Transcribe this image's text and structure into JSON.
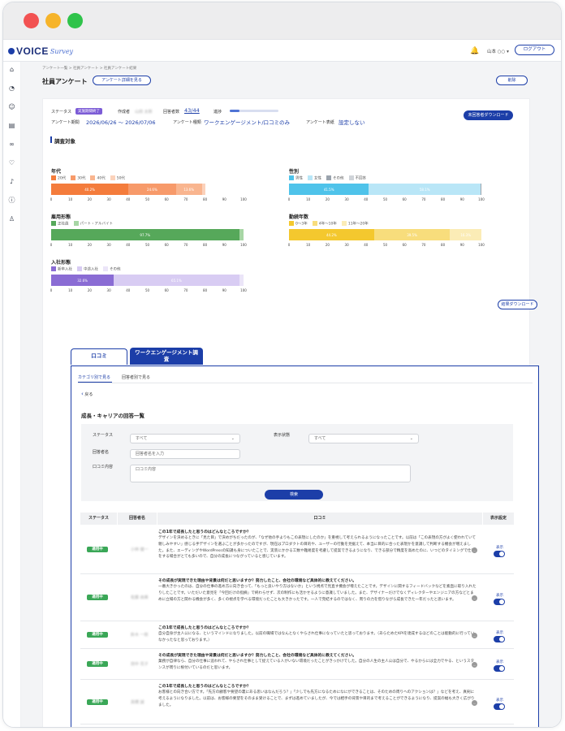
{
  "header": {
    "logo_text": "VOICE",
    "logo_script": "Survey",
    "user_label": "山本 ○○ ▾",
    "logout": "ログアウト"
  },
  "breadcrumb": "アンケート一覧  >  社員アンケート  >  社員アンケート結果",
  "page": {
    "title": "社員アンケート",
    "detail_button": "アンケート詳細を見る",
    "delete_button": "削除"
  },
  "summary": {
    "status_label": "ステータス",
    "status_value": "実施期間終了",
    "author_label": "作成者",
    "author_value": "山田 太郎",
    "respondents_label": "回答者数",
    "respondents_value": "43/44",
    "progress_label": "進捗",
    "progress_fraction": 0.2,
    "period_label": "アンケート期間",
    "period_value": "2026/06/26 〜 2026/07/06",
    "type_label": "アンケート種類",
    "type_value": "ワークエンゲージメント/口コミのみ",
    "display_label": "アンケート表紙",
    "display_value": "設定しない",
    "download_button": "未回答者ダウンロード"
  },
  "target": {
    "title": "調査対象",
    "ticks": [
      "0",
      "10",
      "20",
      "30",
      "40",
      "50",
      "60",
      "70",
      "80",
      "90",
      "100"
    ]
  },
  "chart_data": [
    {
      "type": "bar",
      "title": "年代",
      "categories": [
        "20代",
        "30代",
        "40代",
        "50代"
      ],
      "values": [
        40.2,
        24.6,
        13.6,
        1.6
      ],
      "labels": [
        "40.2%",
        "24.6%",
        "13.6%",
        ""
      ],
      "colors": [
        "#f47c3c",
        "#f79a6a",
        "#f9b58f",
        "#fbd2bb"
      ],
      "xlim": [
        0,
        100
      ]
    },
    {
      "type": "bar",
      "title": "性別",
      "categories": [
        "男性",
        "女性",
        "その他",
        "不回答"
      ],
      "values": [
        41.5,
        58.1,
        0.4,
        0
      ],
      "labels": [
        "41.5%",
        "58.1%",
        "",
        ""
      ],
      "colors": [
        "#4fc3ea",
        "#b9e6f7",
        "#9aa3ad",
        "#cfd3d8"
      ],
      "xlim": [
        0,
        100
      ]
    },
    {
      "type": "bar",
      "title": "雇用形態",
      "categories": [
        "正社員",
        "パート・アルバイト"
      ],
      "values": [
        97.7,
        2.3
      ],
      "labels": [
        "97.7%",
        ""
      ],
      "colors": [
        "#56a85a",
        "#a7d6a5"
      ],
      "xlim": [
        0,
        100
      ]
    },
    {
      "type": "bar",
      "title": "勤続年数",
      "categories": [
        "0〜3年",
        "4年〜10年",
        "11年〜20年"
      ],
      "values": [
        44.2,
        39.5,
        16.3
      ],
      "labels": [
        "44.2%",
        "39.5%",
        "16.3%"
      ],
      "colors": [
        "#f4c82e",
        "#f8dd7c",
        "#fbecb6"
      ],
      "xlim": [
        0,
        100
      ]
    },
    {
      "type": "bar",
      "title": "入社形態",
      "categories": [
        "新卒入社",
        "中途入社",
        "その他"
      ],
      "values": [
        32.6,
        65.1,
        2.3
      ],
      "labels": [
        "32.6%",
        "65.1%",
        ""
      ],
      "colors": [
        "#8a6cd4",
        "#d8ccf3",
        "#ebe5f8"
      ],
      "xlim": [
        0,
        100
      ]
    }
  ],
  "result_download": "結果ダウンロード",
  "tabs": [
    "口コミ",
    "ワークエンゲージメント調査"
  ],
  "subtabs": [
    "カテゴリ別で見る",
    "回答者別で見る"
  ],
  "back": "戻る",
  "list_title": "成長・キャリアの回答一覧",
  "filters": {
    "status_label": "ステータス",
    "status_value": "すべて",
    "display_label": "表示状態",
    "display_value": "すべて",
    "name_label": "回答者名",
    "name_placeholder": "回答者名を入力",
    "comment_label": "口コミ内容",
    "comment_placeholder": "口コミ内容",
    "search": "検索"
  },
  "table": {
    "headers": [
      "ステータス",
      "回答者名",
      "口コミ",
      "表示設定"
    ],
    "rows": [
      {
        "status": "適用中",
        "name": "小林 健一",
        "q": "この1年で成長したと思うのはどんなところですか？",
        "a": "デザインを決めるときに「見た目」で決めがちだったのが、「なぜ他の手よりもこの表現にしたのか」を重視して考えられるようになったことです。以前は「この表現の方がよく使われていて親しみやすい」感じる手デザインを選ぶことが多かったのですが、現在はプロダクトの目的や、ユーザーの行動を見据えて、本当に目的に合った表現かを意識して判断する機会が増えました。また、エーディングやWordPressの知識も身についたことで、実装にかかる工数や難易度を考慮して提案できるようになり、できる部分で精度を高めたのに、いつどのタイミングで仕事をする場合がとても多いので、自分の成長につながっていると感じています。",
        "display": "表示"
      },
      {
        "status": "適用中",
        "name": "佐藤 由美",
        "q": "その成長が実現できた理由や背景は何だと思いますか？努力したこと、会社の環境など具体的に教えてください。",
        "a": "一番大きかったのは、自分の仕事の進め方に向き合って、「もっと良いやり方はないか」という視点で見直す機会が増えたことです。デザインに関するフィードバックなどを素直に取り入れたりしたことです。いただいた意見を「今回だけの指摘」で終わらせず、次の制作にも活かせるように意識していました。また、デザイナーだけでなくディレクターやエンジニアの方などとまめに立場の方と関わる機会が多く、多くの視点を学べる環境だったことも大きかったです。一人で完結するのではなく、周りの力を借りながら成長できた一年だったと思います。",
        "display": "表示"
      },
      {
        "status": "適用中",
        "name": "鈴木 一郎",
        "q": "この1年で成長したと思うのはどんなところですか？",
        "a": "自分自身が主人公になる、というマインドになりました。以前の職場ではなんとなくやらされ仕事になっていたと思っております。（あらためたKPIを達成するほどのことは能動的に行っていなかったなと思っております。）",
        "display": "表示"
      },
      {
        "status": "適用中",
        "name": "田中 花子",
        "q": "その成長が実現できた理由や背景は何だと思いますか？努力したこと、会社の環境など具体的に教えてください。",
        "a": "業務が自律なら、自分の仕事に追われて、やらされ仕事として捉えている人がいない環境だったことがきっかけでした。自分の人生の主人公は自分で、やるからには全力でやる、というスタンスが周りに根付いているのだと思います。",
        "display": "表示"
      },
      {
        "status": "適用中",
        "name": "高橋 誠",
        "q": "この1年で成長したと思うのはどんなところですか？",
        "a": "お客様との向き合い方です。「先方の顧客や要望の裏にある思いはなんだろう？」「少しでも先方になるためになにができることは、そのための周りへのアクションは？」などを考え、真剣に考えるようになりました。以前は、お客様の要望をそのまま受けることで、まずは進めていましたが、今では相手の背景や目的まで考えることができるようになり、提案の幅も大きく広がりました。",
        "display": "表示"
      },
      {
        "status": "適用中",
        "name": "伊藤 美咲",
        "q": "その成長が実現できた理由や背景は何だと思いますか？努力したこと、会社の環境など具体的に教えてください。",
        "a": "実は業務担当を任ぜられたことが一番の要因で、なんだかんだで自分の担当範囲を広げていく中で、上司や先輩から学ぶことができました。「会社のために何ができるか」を意識して考えることが当たり前の環境で、チーム全体として支え合う文化があると思います。",
        "display": "表示"
      }
    ]
  }
}
